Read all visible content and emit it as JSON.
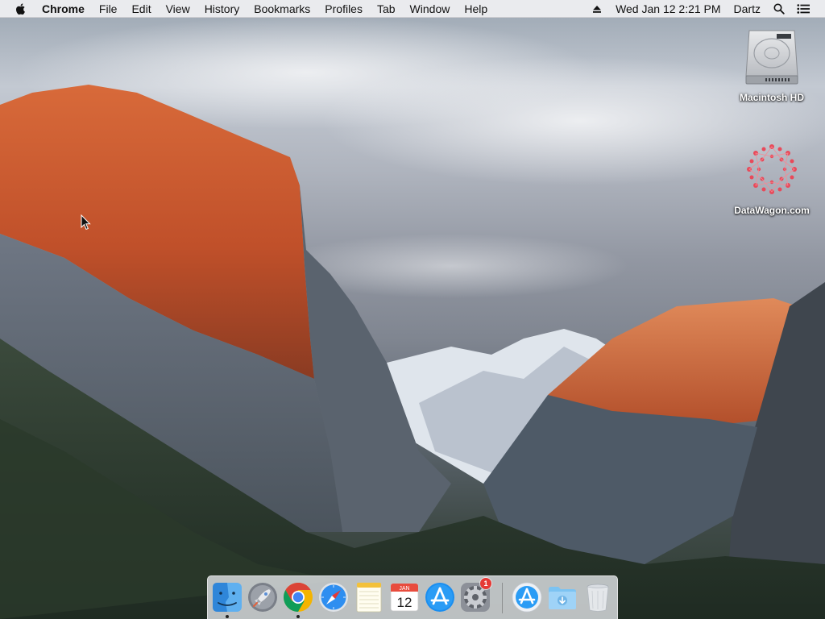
{
  "menubar": {
    "app_name": "Chrome",
    "items": [
      "File",
      "Edit",
      "View",
      "History",
      "Bookmarks",
      "Profiles",
      "Tab",
      "Window",
      "Help"
    ],
    "clock": "Wed Jan 12  2:21 PM",
    "user": "Dartz",
    "icons": [
      "apple-icon",
      "eject-icon",
      "spotlight-search-icon",
      "notification-center-icon"
    ]
  },
  "desktop": {
    "icons": [
      {
        "label": "Macintosh HD",
        "icon": "hard-drive-icon"
      },
      {
        "label": "DataWagon.com",
        "icon": "datawagon-logo-icon"
      }
    ]
  },
  "dock": {
    "items": [
      {
        "name": "finder",
        "icon": "finder-icon",
        "running": true
      },
      {
        "name": "launchpad",
        "icon": "launchpad-rocket-icon",
        "running": false
      },
      {
        "name": "chrome",
        "icon": "chrome-icon",
        "running": true
      },
      {
        "name": "safari",
        "icon": "safari-compass-icon",
        "running": false
      },
      {
        "name": "notes",
        "icon": "notes-icon",
        "running": false
      },
      {
        "name": "calendar",
        "icon": "calendar-icon",
        "running": false
      },
      {
        "name": "app-store",
        "icon": "app-store-icon",
        "running": false
      },
      {
        "name": "system-preferences",
        "icon": "gear-icon",
        "running": false
      },
      {
        "name": "applications-folder",
        "icon": "applications-folder-icon",
        "running": false
      },
      {
        "name": "downloads-folder",
        "icon": "downloads-folder-icon",
        "running": false
      },
      {
        "name": "trash",
        "icon": "trash-icon",
        "running": false
      }
    ],
    "calendar_month": "JAN",
    "calendar_day": "12",
    "system_prefs_badge": "1"
  },
  "colors": {
    "menubar_bg": "#f0f0f2",
    "badge_red": "#e53935",
    "chrome_red": "#db4437",
    "chrome_green": "#0f9d58",
    "chrome_yellow": "#f4b400",
    "chrome_blue": "#4285f4"
  }
}
